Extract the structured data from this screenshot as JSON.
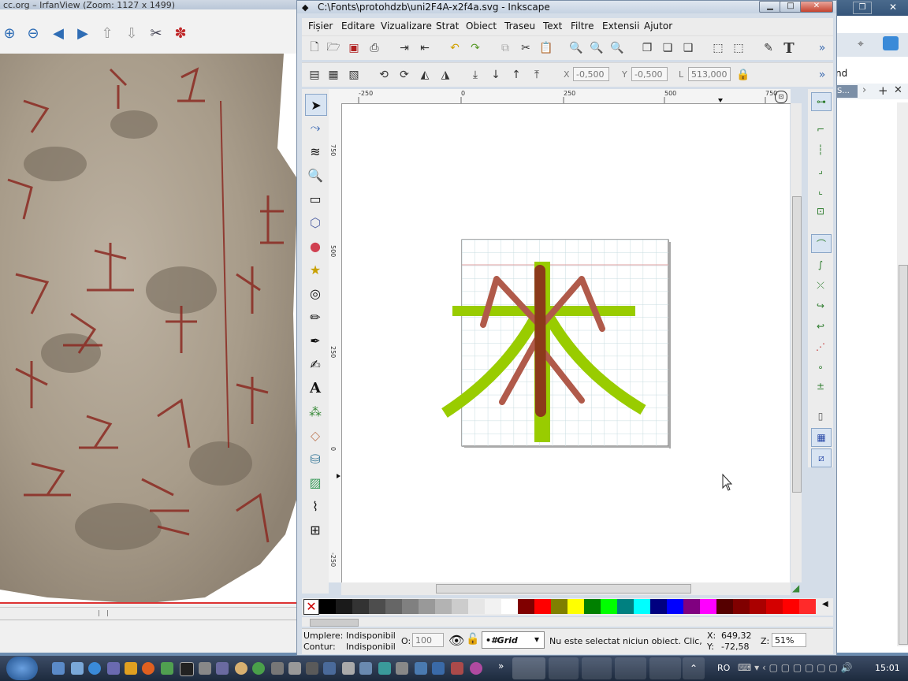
{
  "viewer": {
    "title": "cc.org – IrfanView (Zoom: 1127 x 1499)"
  },
  "inkscape": {
    "title": "C:\\Fonts\\protohdzb\\uni2F4A-x2f4a.svg - Inkscape",
    "menu": [
      "Fișier",
      "Editare",
      "Vizualizare",
      "Strat",
      "Obiect",
      "Traseu",
      "Text",
      "Filtre",
      "Extensii",
      "Ajutor"
    ],
    "controls": {
      "x_label": "X",
      "x_value": "-0,500",
      "y_label": "Y",
      "y_value": "-0,500",
      "w_label": "L",
      "w_value": "513,000"
    },
    "ruler_top": [
      "-250",
      "0",
      "250",
      "500",
      "750"
    ],
    "ruler_left": [
      "750",
      "500",
      "250",
      "0",
      "-250"
    ],
    "status": {
      "fill_label": "Umplere:",
      "fill_value": "Indisponibil",
      "stroke_label": "Contur:",
      "stroke_value": "Indisponibil",
      "opacity_label": "O:",
      "opacity_value": "100",
      "layer": "•#Grid",
      "message": "Nu este selectat niciun obiect. Clic, S...",
      "x_label": "X:",
      "x_value": "649,32",
      "y_label": "Y:",
      "y_value": "-72,58",
      "zoom_label": "Z:",
      "zoom_value": "51%"
    },
    "palette": [
      "#000000",
      "#1a1a1a",
      "#333333",
      "#4d4d4d",
      "#666666",
      "#808080",
      "#999999",
      "#b3b3b3",
      "#cccccc",
      "#e6e6e6",
      "#f2f2f2",
      "#ffffff",
      "#800000",
      "#ff0000",
      "#808000",
      "#ffff00",
      "#008000",
      "#00ff00",
      "#008080",
      "#00ffff",
      "#000080",
      "#0000ff",
      "#800080",
      "#ff00ff",
      "#550000",
      "#800000",
      "#aa0000",
      "#d40000",
      "#ff0000",
      "#ff2a2a"
    ],
    "glyph_colors": {
      "green": "#99cc00",
      "brown": "#8b3a1a",
      "red": "#b05a4a"
    }
  },
  "bg_window": {
    "tab_text": "nd"
  },
  "taskbar": {
    "language": "RO",
    "clock": "15:01"
  }
}
